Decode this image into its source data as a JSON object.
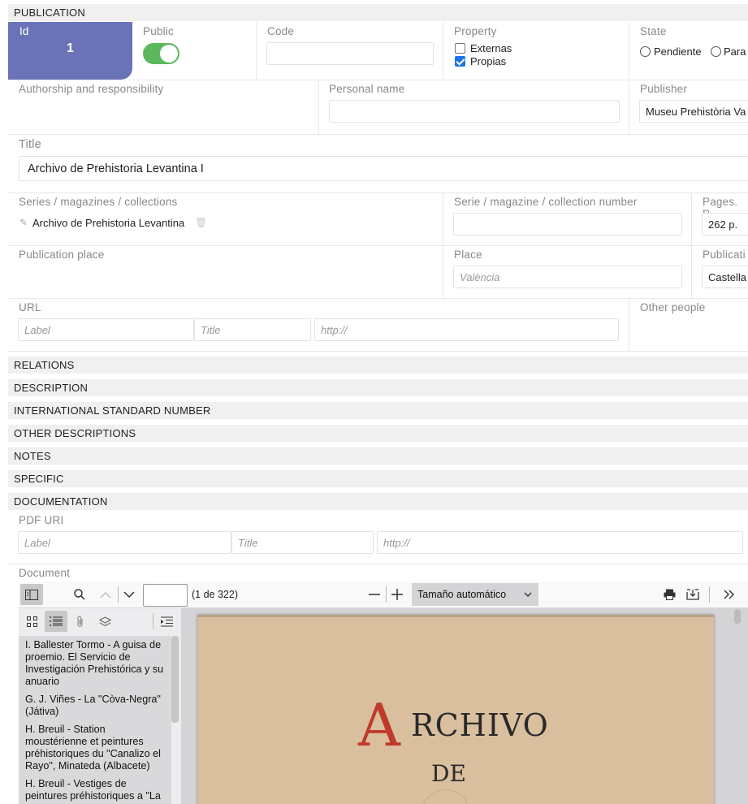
{
  "sections": {
    "publication": "PUBLICATION",
    "relations": "RELATIONS",
    "description": "DESCRIPTION",
    "isn": "INTERNATIONAL STANDARD NUMBER",
    "other_descriptions": "OTHER DESCRIPTIONS",
    "notes": "NOTES",
    "specific": "SPECIFIC",
    "documentation": "DOCUMENTATION"
  },
  "id": {
    "label": "Id",
    "value": "1"
  },
  "public": {
    "label": "Public",
    "on": true
  },
  "code": {
    "label": "Code",
    "value": ""
  },
  "property": {
    "label": "Property",
    "options": [
      {
        "label": "Externas",
        "checked": false
      },
      {
        "label": "Propias",
        "checked": true
      }
    ]
  },
  "state": {
    "label": "State",
    "options": [
      "Pendiente",
      "Para"
    ]
  },
  "authorship": {
    "label": "Authorship and responsibility"
  },
  "personal_name": {
    "label": "Personal name",
    "value": ""
  },
  "publisher": {
    "label": "Publisher",
    "value": "Museu Prehistòria Va"
  },
  "title": {
    "label": "Title",
    "value": "Archivo de Prehistoria Levantina I"
  },
  "series": {
    "label": "Series / magazines / collections",
    "item": "Archivo de Prehistoria Levantina"
  },
  "serie_number": {
    "label": "Serie / magazine / collection number",
    "value": ""
  },
  "pages": {
    "label": "Pages. P",
    "value": "262 p."
  },
  "publication_place": {
    "label": "Publication place"
  },
  "place": {
    "label": "Place",
    "placeholder": "València"
  },
  "publication_lang": {
    "label": "Publicati",
    "value": "Castella"
  },
  "url": {
    "label": "URL",
    "label_placeholder": "Label",
    "title_placeholder": "Title",
    "url_placeholder": "http://"
  },
  "other_people": {
    "label": "Other people"
  },
  "pdf_uri": {
    "label": "PDF URI",
    "label_placeholder": "Label",
    "title_placeholder": "Title",
    "url_placeholder": "http://"
  },
  "document": {
    "label": "Document",
    "page_count": "(1 de 322)",
    "page_input": "",
    "zoom": "Tamaño automático",
    "outline": [
      "I. Ballester Tormo - A guisa de proemio. El Servicio de Investigación Prehistórica y su anuario",
      "G. J. Viñes - La \"Còva-Negra\" (Játiva)",
      "H. Breuil - Station moustérienne et peintures préhistoriques du \"Canalizo el Rayo\", Minateda (Albacete)",
      "H. Breuil - Vestiges de peintures préhistoriques a \"La"
    ],
    "page_title_1": "RCHIVO",
    "page_title_initial": "A",
    "page_title_2": "DE"
  }
}
